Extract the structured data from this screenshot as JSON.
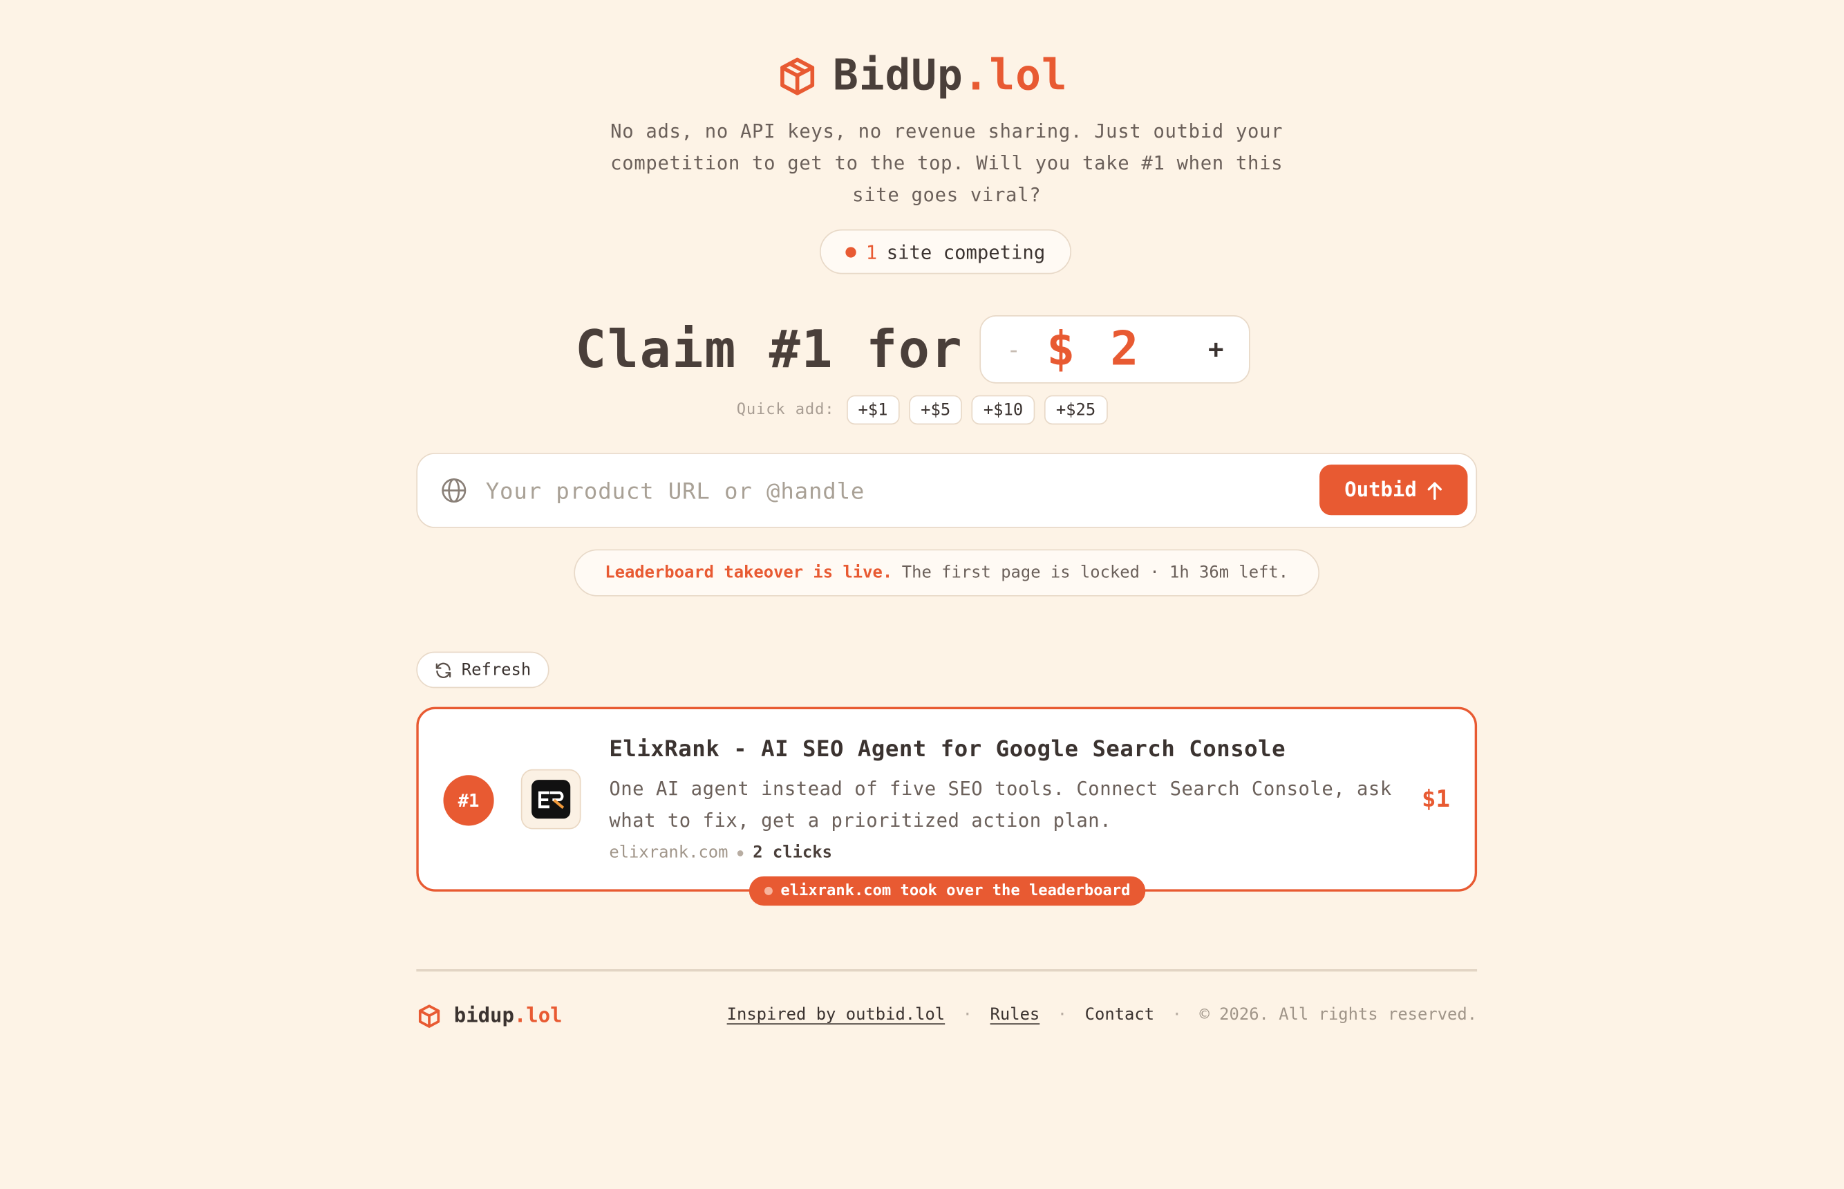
{
  "header": {
    "brand_main": "BidUp",
    "brand_accent": ".lol",
    "tagline": "No ads, no API keys, no revenue sharing. Just outbid your competition to get to the top. Will you take #1 when this site goes viral?"
  },
  "competing": {
    "count": "1",
    "label": "site competing"
  },
  "claim": {
    "text": "Claim #1 for",
    "minus": "-",
    "amount": "$ 2",
    "plus": "+"
  },
  "quick_add": {
    "label": "Quick add:",
    "options": [
      "+$1",
      "+$5",
      "+$10",
      "+$25"
    ]
  },
  "url_form": {
    "placeholder": "Your product URL or @handle",
    "value": "",
    "button_label": "Outbid"
  },
  "banner": {
    "live_text": "Leaderboard takeover is live.",
    "info_text": "The first page is locked · 1h 36m left."
  },
  "refresh": {
    "label": "Refresh"
  },
  "leaderboard": [
    {
      "rank": "#1",
      "title": "ElixRank - AI SEO Agent for Google Search Console",
      "description": "One AI agent instead of five SEO tools. Connect Search Console, ask what to fix, get a prioritized action plan.",
      "domain": "elixrank.com",
      "clicks": "2 clicks",
      "price": "$1",
      "logo_text": "ER"
    }
  ],
  "takeover_notice": "elixrank.com took over the leaderboard",
  "footer": {
    "brand_main": "bidup",
    "brand_accent": ".lol",
    "inspired": "Inspired by outbid.lol",
    "sep": "·",
    "rules": "Rules",
    "contact": "Contact",
    "copyright": "© 2026. All rights reserved."
  },
  "colors": {
    "accent": "#e85a32",
    "background": "#fdf3e6",
    "text": "#4a3f3a"
  },
  "icons": {
    "logo": "cube-icon",
    "url": "globe-icon",
    "outbid": "arrow-up-icon",
    "refresh": "refresh-icon"
  }
}
